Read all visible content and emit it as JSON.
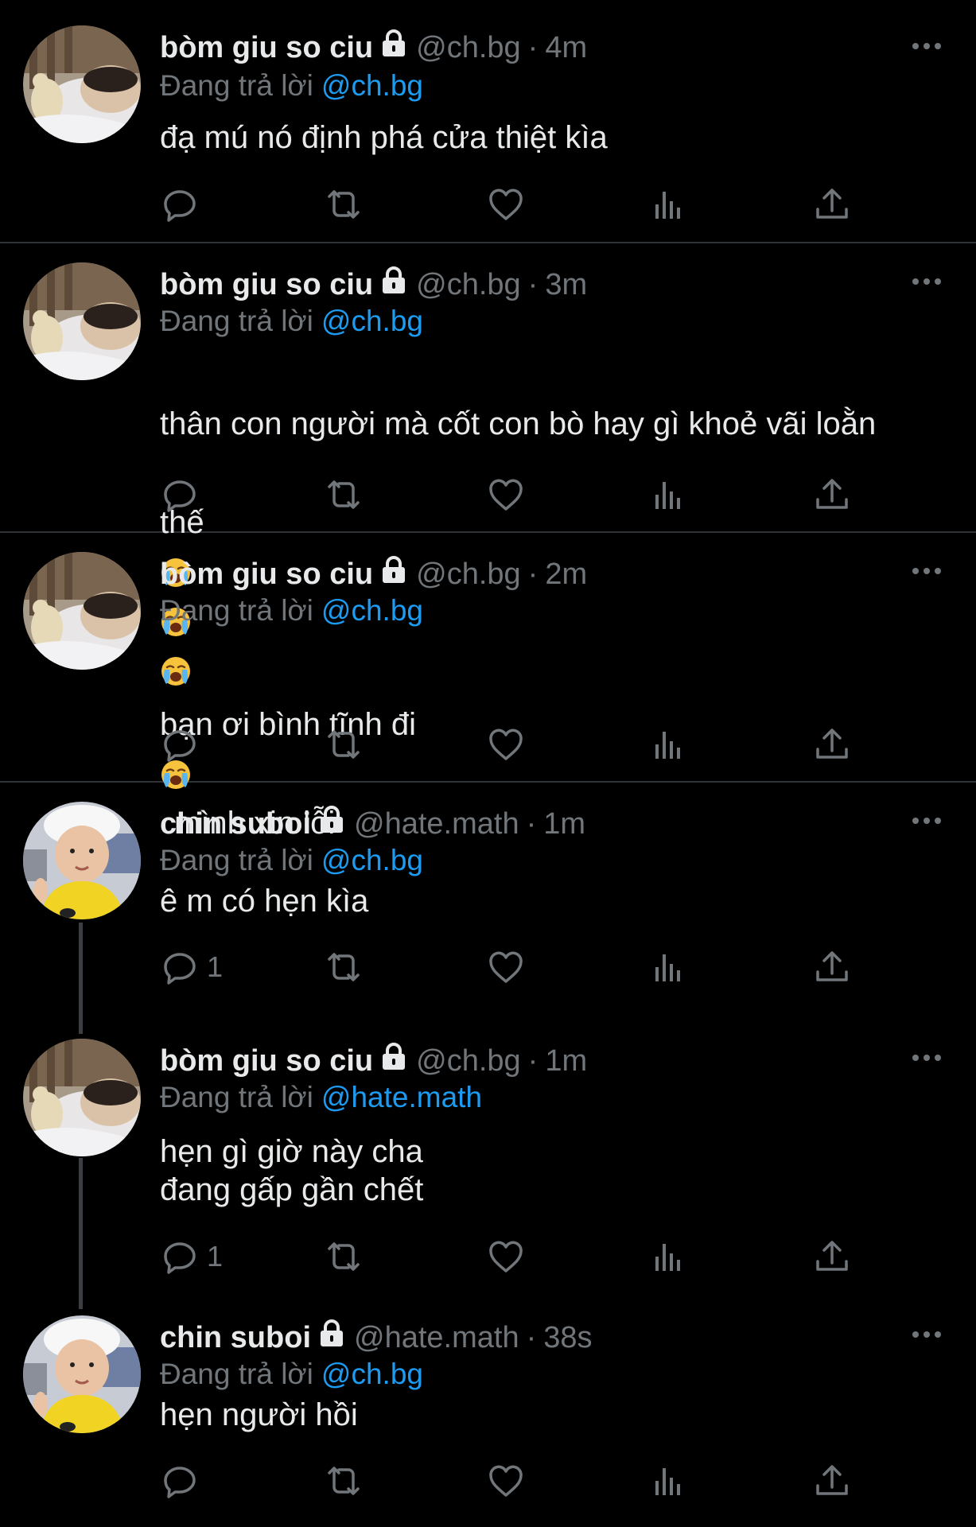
{
  "tweets": [
    {
      "name": "bòm giu so ciu",
      "handle": "@ch.bg",
      "dot": "·",
      "time": "4m",
      "reply_prefix": "Đang trả lời",
      "reply_to": "@ch.bg",
      "text": "đạ mú nó định phá cửa thiệt kìa",
      "reply_count": ""
    },
    {
      "name": "bòm giu so ciu",
      "handle": "@ch.bg",
      "dot": "·",
      "time": "3m",
      "reply_prefix": "Đang trả lời",
      "reply_to": "@ch.bg",
      "text_line1": "thân con người mà cốt con bò hay gì khoẻ vãi loằn",
      "text_line2": "thế",
      "reply_count": ""
    },
    {
      "name": "bòm giu so ciu",
      "handle": "@ch.bg",
      "dot": "·",
      "time": "2m",
      "reply_prefix": "Đang trả lời",
      "reply_to": "@ch.bg",
      "text_a": "bạn ơi bình tĩnh đi",
      "text_b": "mình xin lỗi",
      "reply_count": ""
    },
    {
      "name": "chin suboi",
      "handle": "@hate.math",
      "dot": "·",
      "time": "1m",
      "reply_prefix": "Đang trả lời",
      "reply_to": "@ch.bg",
      "text": "ê m có hẹn kìa",
      "reply_count": "1"
    },
    {
      "name": "bòm giu so ciu",
      "handle": "@ch.bg",
      "dot": "·",
      "time": "1m",
      "reply_prefix": "Đang trả lời",
      "reply_to": "@hate.math",
      "text": "hẹn gì giờ này cha\nđang gấp gần chết",
      "reply_count": "1"
    },
    {
      "name": "chin suboi",
      "handle": "@hate.math",
      "dot": "·",
      "time": "38s",
      "reply_prefix": "Đang trả lời",
      "reply_to": "@ch.bg",
      "text": "hẹn người hồi",
      "reply_count": ""
    }
  ],
  "icons": {
    "protected": "lock-icon",
    "more": "more-dots-icon",
    "reply": "reply-bubble-icon",
    "retweet": "retweet-icon",
    "like": "heart-icon",
    "views": "views-bar-chart-icon",
    "share": "share-upload-icon",
    "emoji": "loudly-crying-face-emoji"
  },
  "colors": {
    "background": "#000000",
    "text": "#e7e9ea",
    "muted": "#71767b",
    "link": "#1d9bf0",
    "divider": "#2f3336"
  }
}
